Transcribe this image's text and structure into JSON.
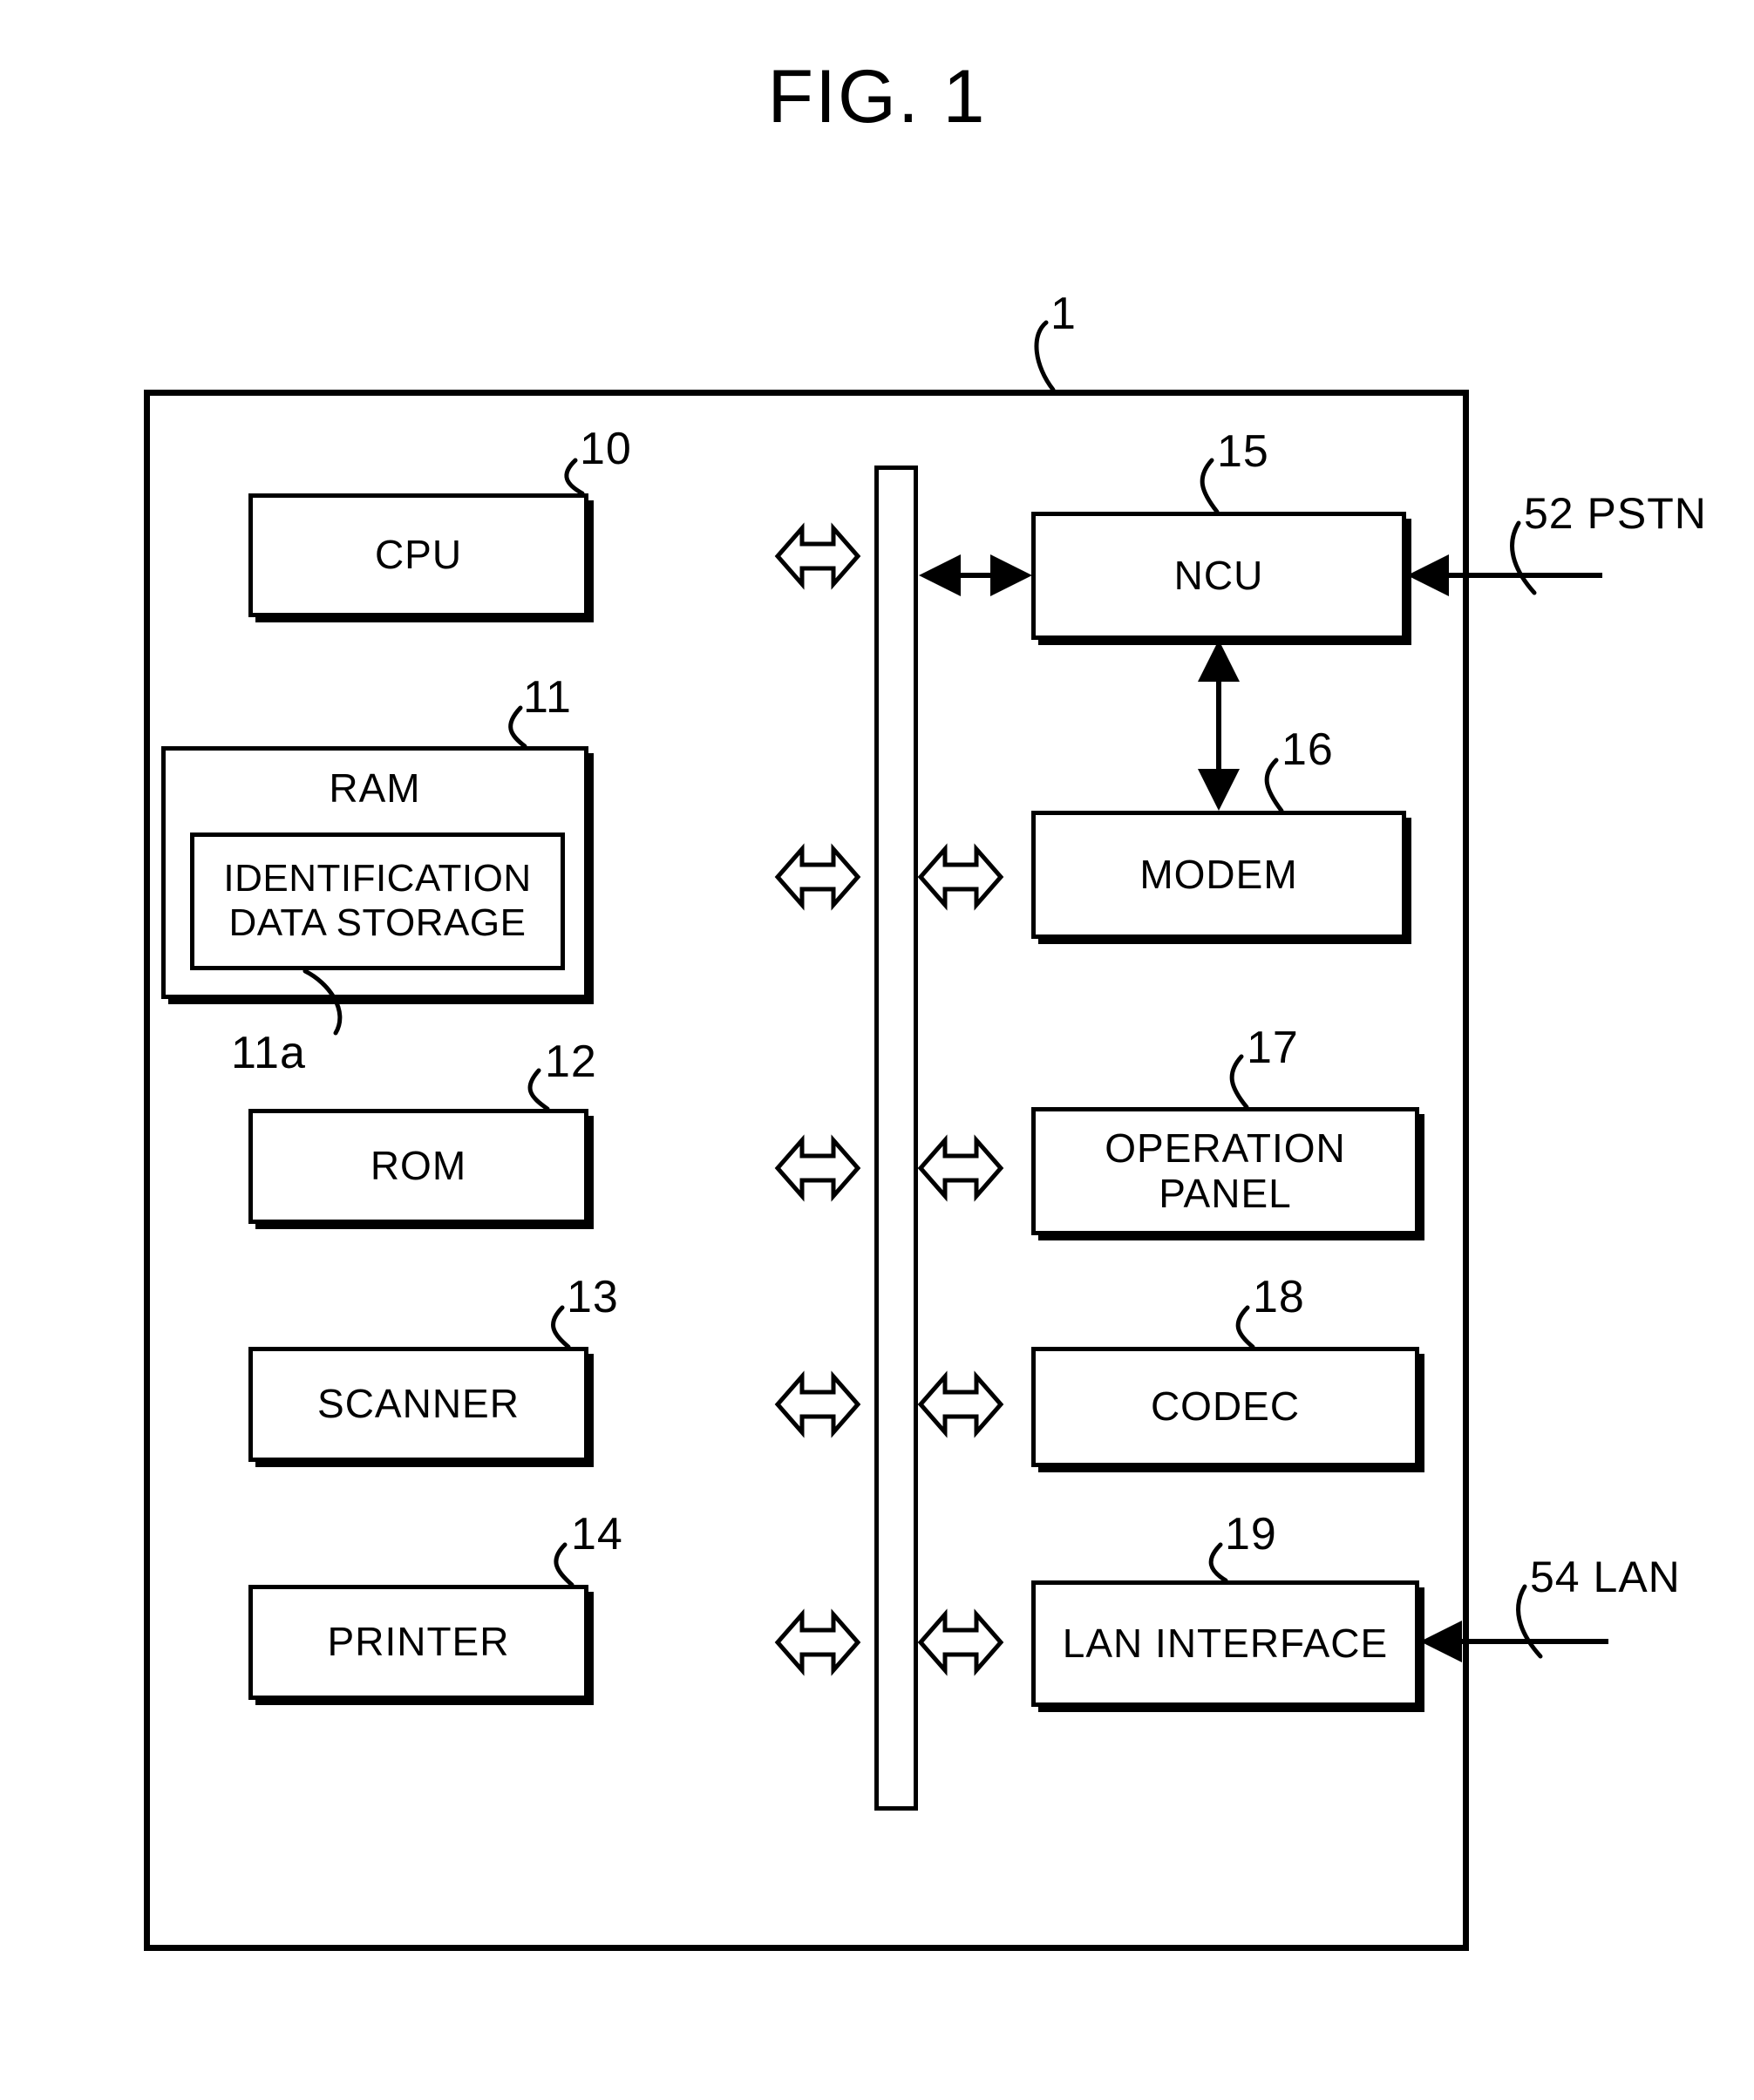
{
  "figure": {
    "title": "FIG. 1",
    "apparatus_ref": "1"
  },
  "blocks": [
    {
      "id": "cpu",
      "label": "CPU",
      "ref": "10",
      "side": "left"
    },
    {
      "id": "ram",
      "label": "RAM",
      "ref": "11",
      "side": "left"
    },
    {
      "id": "id-storage",
      "label": "IDENTIFICATION DATA STORAGE",
      "ref": "11a",
      "side": "left"
    },
    {
      "id": "rom",
      "label": "ROM",
      "ref": "12",
      "side": "left"
    },
    {
      "id": "scanner",
      "label": "SCANNER",
      "ref": "13",
      "side": "left"
    },
    {
      "id": "printer",
      "label": "PRINTER",
      "ref": "14",
      "side": "left"
    },
    {
      "id": "ncu",
      "label": "NCU",
      "ref": "15",
      "side": "right"
    },
    {
      "id": "modem",
      "label": "MODEM",
      "ref": "16",
      "side": "right"
    },
    {
      "id": "op-panel",
      "label": "OPERATION PANEL",
      "ref": "17",
      "side": "right"
    },
    {
      "id": "codec",
      "label": "CODEC",
      "ref": "18",
      "side": "right"
    },
    {
      "id": "lan-if",
      "label": "LAN INTERFACE",
      "ref": "19",
      "side": "right"
    }
  ],
  "external": [
    {
      "id": "pstn",
      "label": "52 PSTN",
      "connects_to": "ncu"
    },
    {
      "id": "lan",
      "label": "54 LAN",
      "connects_to": "lan-if"
    }
  ],
  "bus": {
    "name": "internal-bus",
    "connections": [
      "cpu",
      "ram",
      "rom",
      "scanner",
      "printer",
      "ncu",
      "modem",
      "op-panel",
      "codec",
      "lan-if"
    ]
  },
  "colors": {
    "ink": "#000000",
    "paper": "#ffffff"
  }
}
